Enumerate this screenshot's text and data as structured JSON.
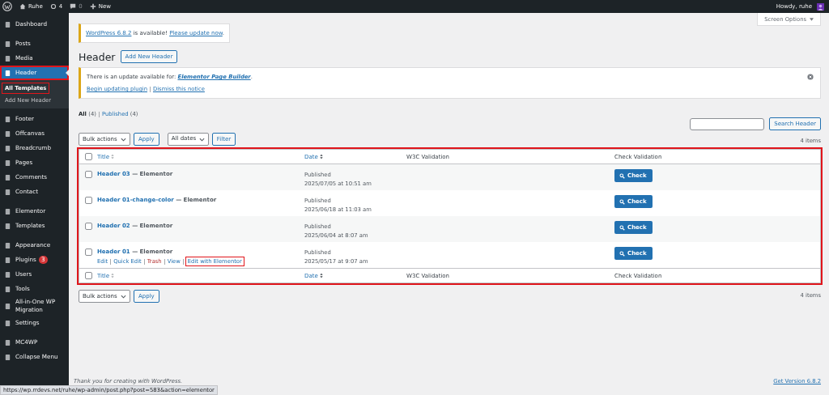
{
  "admin_bar": {
    "site": "Ruhe",
    "updates": "4",
    "comments": "0",
    "new": "New",
    "greeting": "Howdy, ruhe"
  },
  "sidebar": {
    "groups": [
      [
        {
          "label": "Dashboard",
          "selected": false,
          "highlighted": false
        }
      ],
      [
        {
          "label": "Posts",
          "selected": false,
          "highlighted": false
        },
        {
          "label": "Media",
          "selected": false,
          "highlighted": false
        },
        {
          "label": "Header",
          "selected": true,
          "highlighted": true,
          "children": [
            {
              "label": "All Templates",
              "selected": true,
              "highlighted": true
            },
            {
              "label": "Add New Header",
              "selected": false,
              "highlighted": false
            }
          ]
        },
        {
          "label": "Footer",
          "selected": false,
          "highlighted": false
        },
        {
          "label": "Offcanvas",
          "selected": false,
          "highlighted": false
        },
        {
          "label": "Breadcrumb",
          "selected": false,
          "highlighted": false
        },
        {
          "label": "Pages",
          "selected": false,
          "highlighted": false
        },
        {
          "label": "Comments",
          "selected": false,
          "highlighted": false
        },
        {
          "label": "Contact",
          "selected": false,
          "highlighted": false
        }
      ],
      [
        {
          "label": "Elementor",
          "selected": false,
          "highlighted": false
        },
        {
          "label": "Templates",
          "selected": false,
          "highlighted": false
        }
      ],
      [
        {
          "label": "Appearance",
          "selected": false,
          "highlighted": false
        },
        {
          "label": "Plugins",
          "selected": false,
          "highlighted": false,
          "badge": "3"
        },
        {
          "label": "Users",
          "selected": false,
          "highlighted": false
        },
        {
          "label": "Tools",
          "selected": false,
          "highlighted": false
        },
        {
          "label": "All-in-One WP Migration",
          "selected": false,
          "highlighted": false
        },
        {
          "label": "Settings",
          "selected": false,
          "highlighted": false
        }
      ],
      [
        {
          "label": "MC4WP",
          "selected": false,
          "highlighted": false
        },
        {
          "label": "Collapse Menu",
          "selected": false,
          "highlighted": false
        }
      ]
    ]
  },
  "screen_options": "Screen Options",
  "wp_notice": {
    "link": "WordPress 6.8.2",
    "text": " is available! ",
    "action": "Please update now",
    "end": "."
  },
  "page_title": "Header",
  "add_new": "Add New Header",
  "plugin_notice": {
    "text": "There is an update available for: ",
    "plugin": "Elementor Page Builder",
    "end": ".",
    "actions": [
      "Begin updating plugin",
      "Dismiss this notice"
    ]
  },
  "filters": [
    {
      "label": "All",
      "count": "(4)",
      "selected": true
    },
    {
      "label": "Published",
      "count": "(4)",
      "selected": false
    }
  ],
  "search_button": "Search Header",
  "bulk_actions": "Bulk actions",
  "apply": "Apply",
  "dates": "All dates",
  "filter": "Filter",
  "items_count": "4 items",
  "table": {
    "highlighted": true,
    "columns": [
      "Title",
      "Date",
      "W3C Validation",
      "Check Validation"
    ],
    "footer_columns": [
      "Title",
      "Date",
      "W3C Validation",
      "Check Validation"
    ],
    "rows": [
      {
        "title": "Header 03",
        "suffix": " — Elementor",
        "status": "Published",
        "date": "2025/07/05 at 10:51 am",
        "check": "Check"
      },
      {
        "title": "Header 01-change-color",
        "suffix": " — Elementor",
        "status": "Published",
        "date": "2025/06/18 at 11:03 am",
        "check": "Check"
      },
      {
        "title": "Header 02",
        "suffix": " — Elementor",
        "status": "Published",
        "date": "2025/06/04 at 8:07 am",
        "check": "Check"
      },
      {
        "title": "Header 01",
        "suffix": " — Elementor",
        "status": "Published",
        "date": "2025/05/17 at 9:07 am",
        "check": "Check",
        "actions": [
          {
            "label": "Edit",
            "kind": "link",
            "highlighted": false
          },
          {
            "label": "Quick Edit",
            "kind": "link",
            "highlighted": false
          },
          {
            "label": "Trash",
            "kind": "delete",
            "highlighted": false
          },
          {
            "label": "View",
            "kind": "link",
            "highlighted": false
          },
          {
            "label": "Edit with Elementor",
            "kind": "link",
            "highlighted": true
          }
        ]
      }
    ]
  },
  "bottom_nav": {
    "bulk_actions": "Bulk actions",
    "apply": "Apply",
    "items_count": "4 items"
  },
  "footer": {
    "text": "Thank you for creating with WordPress.",
    "version": "Get Version 6.8.2"
  },
  "status_url": "https://wp.rrdevs.net/ruhe/wp-admin/post.php?post=583&action=elementor"
}
